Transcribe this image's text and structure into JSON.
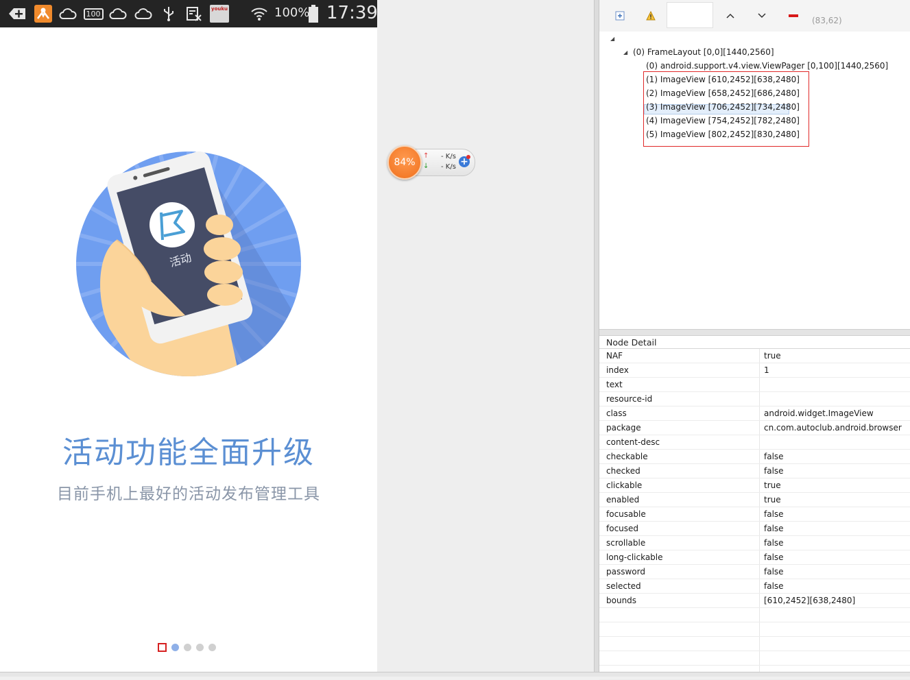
{
  "status_bar": {
    "battery_percent": "100%",
    "time": "17:39",
    "badge_100": "100",
    "youku_badge": "youku"
  },
  "app": {
    "hero_label": "活动",
    "headline": "活动功能全面升级",
    "subline": "目前手机上最好的活动发布管理工具",
    "page_count": 5,
    "selected_page": 0
  },
  "speed_widget": {
    "percent": "84%",
    "upload": "- K/s",
    "download": "- K/s"
  },
  "toolbar": {
    "coords": "(83,62)"
  },
  "tree": {
    "nodes": [
      "(0) FrameLayout [0,0][1440,2560]",
      "(0) android.support.v4.view.ViewPager [0,100][1440,2560]",
      "(1) ImageView [610,2452][638,2480]",
      "(2) ImageView [658,2452][686,2480]",
      "(3) ImageView [706,2452][734,2480]",
      "(4) ImageView [754,2452][782,2480]",
      "(5) ImageView [802,2452][830,2480]"
    ]
  },
  "node_detail": {
    "title": "Node Detail",
    "rows": [
      {
        "key": "NAF",
        "value": "true"
      },
      {
        "key": "index",
        "value": "1"
      },
      {
        "key": "text",
        "value": ""
      },
      {
        "key": "resource-id",
        "value": ""
      },
      {
        "key": "class",
        "value": "android.widget.ImageView"
      },
      {
        "key": "package",
        "value": "cn.com.autoclub.android.browser"
      },
      {
        "key": "content-desc",
        "value": ""
      },
      {
        "key": "checkable",
        "value": "false"
      },
      {
        "key": "checked",
        "value": "false"
      },
      {
        "key": "clickable",
        "value": "true"
      },
      {
        "key": "enabled",
        "value": "true"
      },
      {
        "key": "focusable",
        "value": "false"
      },
      {
        "key": "focused",
        "value": "false"
      },
      {
        "key": "scrollable",
        "value": "false"
      },
      {
        "key": "long-clickable",
        "value": "false"
      },
      {
        "key": "password",
        "value": "false"
      },
      {
        "key": "selected",
        "value": "false"
      },
      {
        "key": "bounds",
        "value": "[610,2452][638,2480]"
      }
    ]
  },
  "colors": {
    "headline": "#5b8fd3",
    "hero_circle": "#6f9ef0",
    "widget_orange": "#f57a25",
    "selection_red": "#e02828"
  }
}
